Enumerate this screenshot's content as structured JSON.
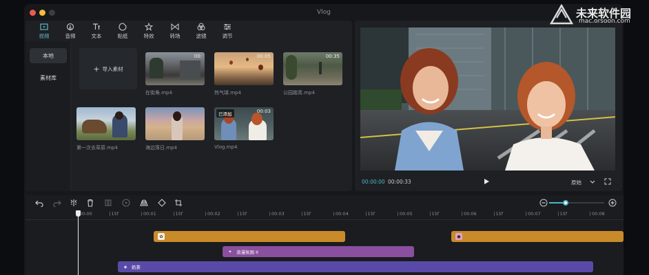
{
  "window": {
    "title": "Vlog"
  },
  "tabs": [
    {
      "label": "视频",
      "icon": "video-tab-icon"
    },
    {
      "label": "音频",
      "icon": "audio-tab-icon"
    },
    {
      "label": "文本",
      "icon": "text-tab-icon"
    },
    {
      "label": "贴纸",
      "icon": "sticker-tab-icon"
    },
    {
      "label": "特效",
      "icon": "effects-tab-icon"
    },
    {
      "label": "转场",
      "icon": "transition-tab-icon"
    },
    {
      "label": "滤镜",
      "icon": "filter-tab-icon"
    },
    {
      "label": "调节",
      "icon": "adjust-tab-icon"
    }
  ],
  "sidebar": {
    "items": [
      {
        "label": "本地"
      },
      {
        "label": "素材库"
      }
    ]
  },
  "media": {
    "import_label": "导入素材",
    "clips": [
      {
        "name": "在街角.mp4",
        "duration": "00:"
      },
      {
        "name": "热气球.mp4",
        "duration": "00:05"
      },
      {
        "name": "公园踏青.mp4",
        "duration": "00:35"
      },
      {
        "name": "第一次去草原.mp4",
        "duration": ""
      },
      {
        "name": "海边落日.mp4",
        "duration": ""
      },
      {
        "name": "Vlog.mp4",
        "duration": "00:03",
        "badge": "已添加"
      }
    ]
  },
  "preview": {
    "current_time": "00:00:00",
    "total_time": "00:00:33",
    "ratio_label": "原始"
  },
  "timeline": {
    "ruler": [
      "00:00",
      "15f",
      "00:01",
      "15f",
      "00:02",
      "15f",
      "00:03",
      "15f",
      "00:04",
      "15f",
      "00:05",
      "15f",
      "00:06",
      "15f",
      "00:07",
      "15f",
      "00:08"
    ],
    "tracks": [
      {
        "label": ""
      },
      {
        "label": ""
      },
      {
        "label": "浪漫氛围 II"
      },
      {
        "label": "奶茶"
      }
    ],
    "zoom_level": 0.3
  },
  "colors": {
    "accent": "#4fb6c7",
    "track_orange": "#c98b2a",
    "track_purple": "#8a4f9e",
    "track_indigo": "#5a4aa8",
    "track_teal": "#2f7f8a"
  },
  "watermark": {
    "main": "未来软件园",
    "sub": "mac.orsoon.com"
  }
}
